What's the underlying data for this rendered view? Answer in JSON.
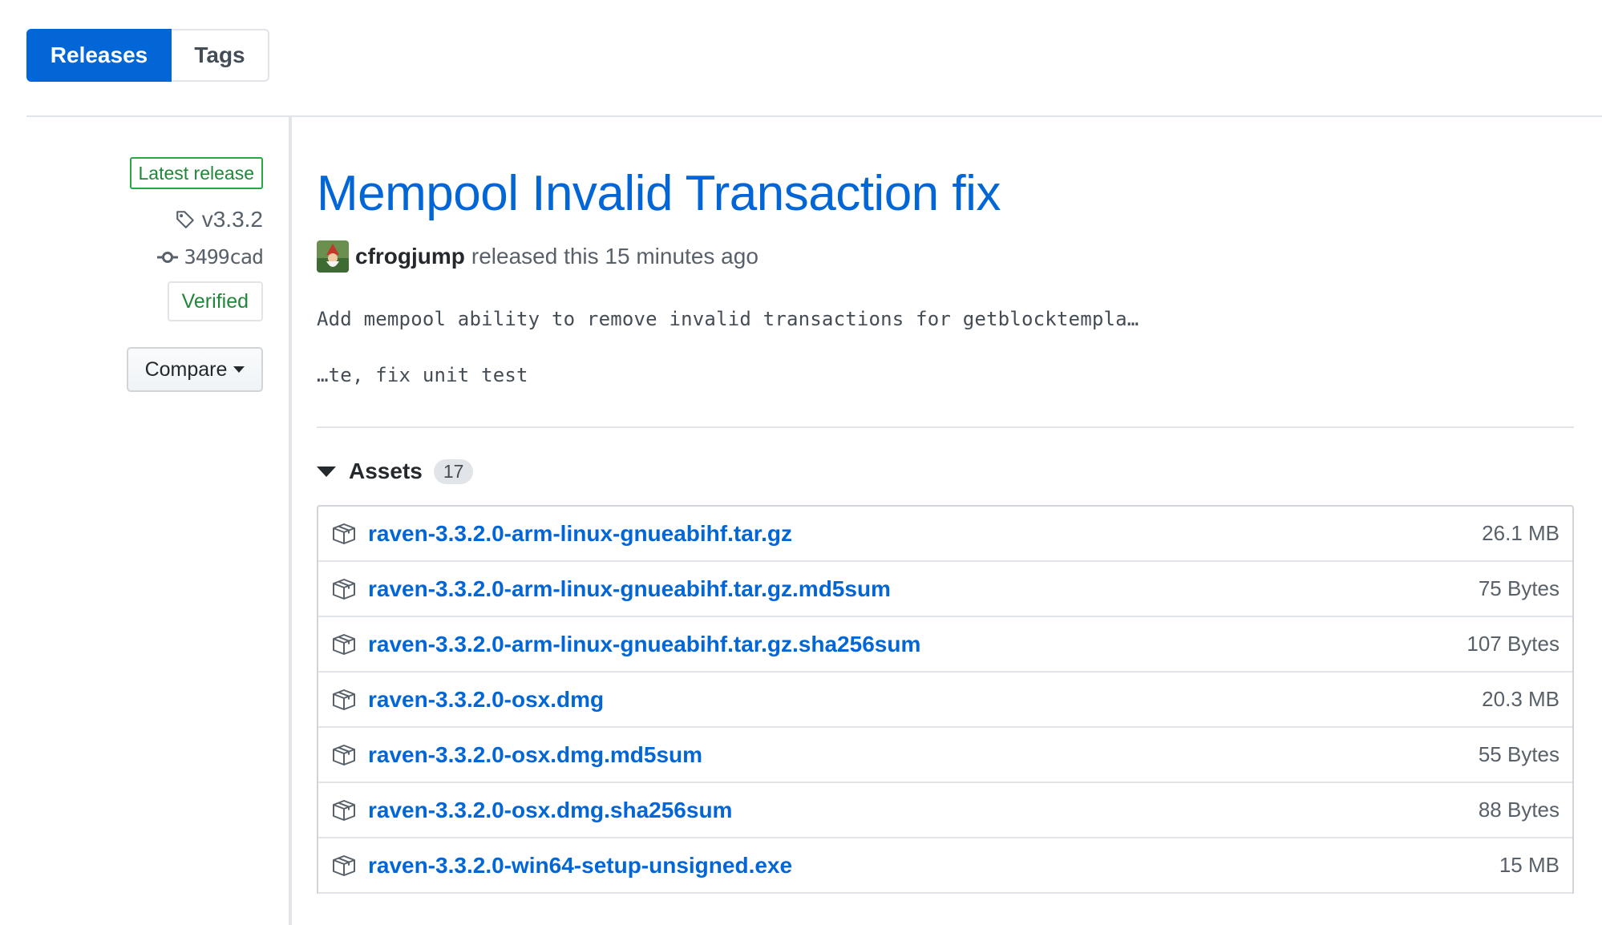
{
  "tabs": {
    "releases": "Releases",
    "tags": "Tags"
  },
  "sidebar": {
    "latest_label": "Latest release",
    "tag": "v3.3.2",
    "commit": "3499cad",
    "verified": "Verified",
    "compare": "Compare"
  },
  "release": {
    "title": "Mempool Invalid Transaction fix",
    "author": "cfrogjump",
    "released_text": "released this 15 minutes ago",
    "body_line1": "Add mempool ability to remove invalid transactions for getblocktempla…",
    "body_line2": "…te, fix unit test"
  },
  "assets": {
    "label": "Assets",
    "count": "17",
    "items": [
      {
        "name": "raven-3.3.2.0-arm-linux-gnueabihf.tar.gz",
        "size": "26.1 MB"
      },
      {
        "name": "raven-3.3.2.0-arm-linux-gnueabihf.tar.gz.md5sum",
        "size": "75 Bytes"
      },
      {
        "name": "raven-3.3.2.0-arm-linux-gnueabihf.tar.gz.sha256sum",
        "size": "107 Bytes"
      },
      {
        "name": "raven-3.3.2.0-osx.dmg",
        "size": "20.3 MB"
      },
      {
        "name": "raven-3.3.2.0-osx.dmg.md5sum",
        "size": "55 Bytes"
      },
      {
        "name": "raven-3.3.2.0-osx.dmg.sha256sum",
        "size": "88 Bytes"
      },
      {
        "name": "raven-3.3.2.0-win64-setup-unsigned.exe",
        "size": "15 MB"
      }
    ]
  },
  "colors": {
    "accent": "#0366d6",
    "verified_green": "#22863a",
    "border": "#e1e4e8"
  },
  "icons": {
    "tag": "tag-icon",
    "commit": "git-commit-icon",
    "package": "package-icon",
    "caret": "triangle-down-icon"
  }
}
